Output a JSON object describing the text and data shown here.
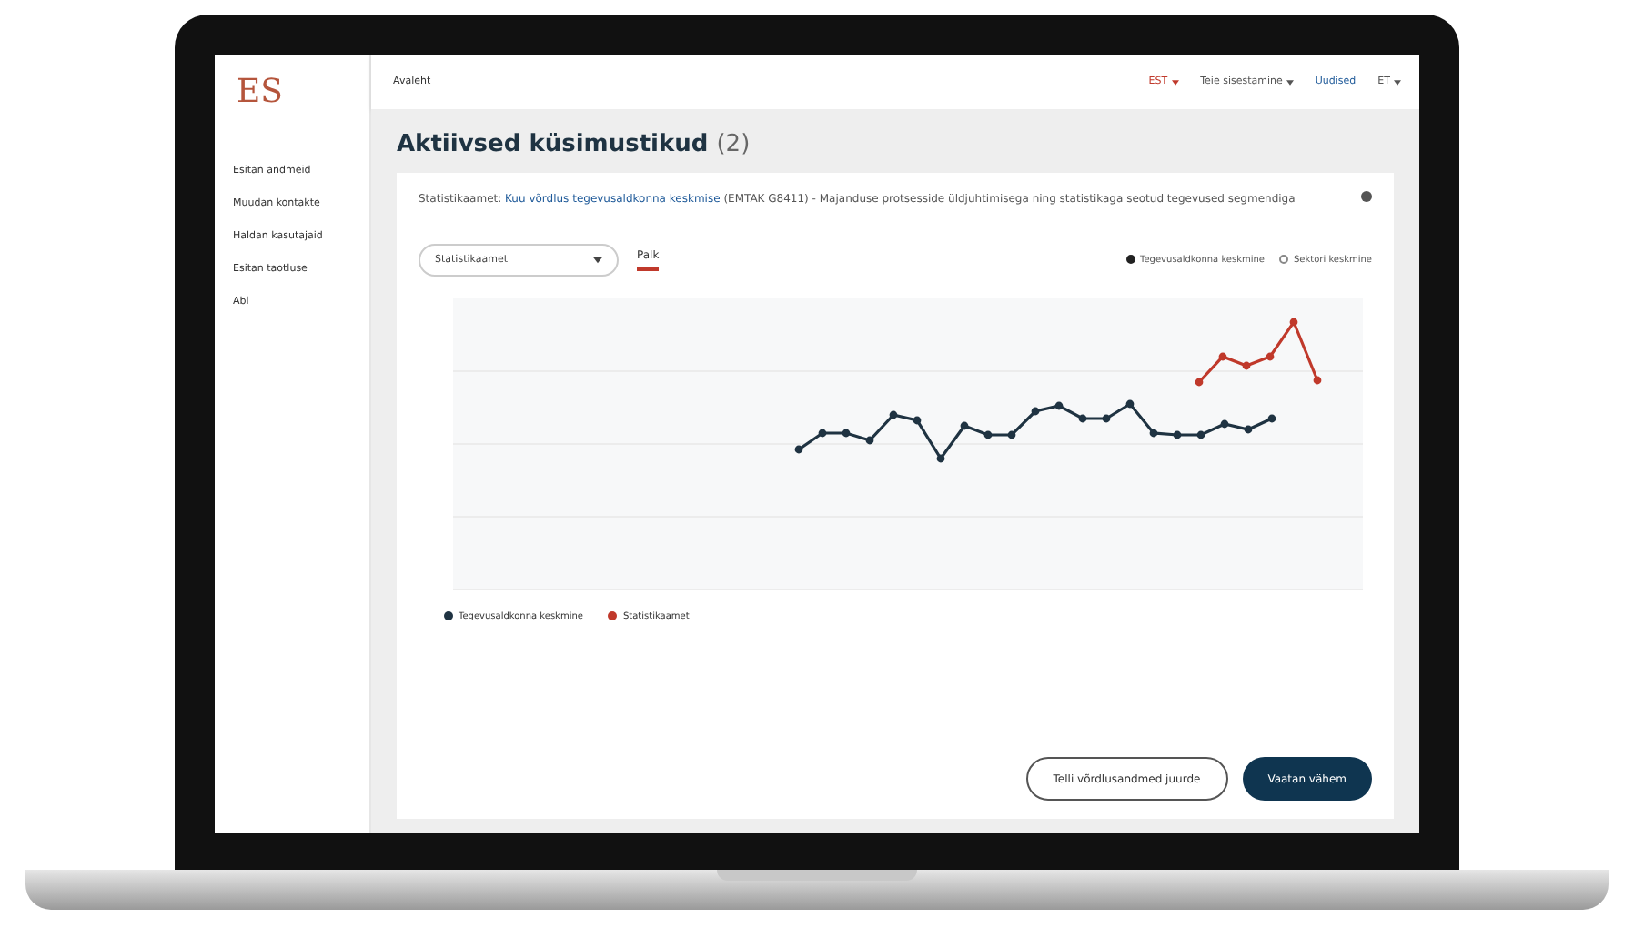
{
  "logo": {
    "mark": "ES"
  },
  "breadcrumb": "Avaleht",
  "top_menu": [
    {
      "label": "EST",
      "kind": "accent"
    },
    {
      "label": "Teie sisestamine",
      "kind": "dropdown"
    },
    {
      "label": "Uudised",
      "kind": "link"
    },
    {
      "label": "ET",
      "kind": "dropdown"
    }
  ],
  "sidebar": {
    "items": [
      {
        "label": "Esitan andmeid"
      },
      {
        "label": "Muudan kontakte"
      },
      {
        "label": "Haldan kasutajaid"
      },
      {
        "label": "Esitan taotluse"
      },
      {
        "label": "Abi"
      }
    ]
  },
  "page": {
    "title": "Aktiivsed küsimustikud",
    "count": "(2)"
  },
  "card": {
    "source": "Statistikaamet:",
    "link": "Kuu võrdlus tegevusaldkonna keskmise",
    "description": "(EMTAK G8411) - Majanduse protsesside üldjuhtimisega ning statistikaga seotud tegevused segmendiga",
    "select": {
      "value": "Statistikaamet"
    },
    "tabs": [
      {
        "label": "Palk",
        "selected": true
      }
    ],
    "compare": [
      {
        "label": "Tegevusaldkonna keskmine",
        "selected": true
      },
      {
        "label": "Sektori keskmine",
        "selected": false
      }
    ],
    "legend": [
      {
        "label": "Tegevusaldkonna keskmine",
        "color": "#1f3342"
      },
      {
        "label": "Statistikaamet",
        "color": "#c0392b"
      }
    ],
    "buttons": [
      {
        "label": "Telli võrdlusandmed juurde",
        "kind": "outline"
      },
      {
        "label": "Vaatan vähem",
        "kind": "primary"
      }
    ]
  }
}
